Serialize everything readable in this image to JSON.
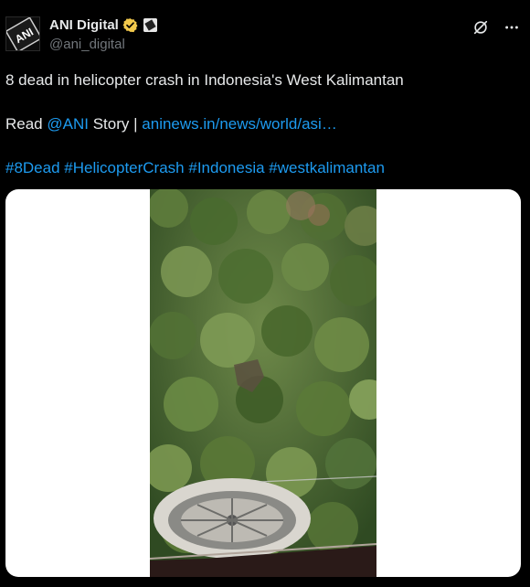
{
  "author": {
    "display_name": "ANI Digital",
    "handle": "@ani_digital",
    "avatar_text": "ANI",
    "verified_badge": "gold-check",
    "affiliate_badge": "ANI"
  },
  "tweet": {
    "headline": "8 dead in helicopter crash in Indonesia's West Kalimantan",
    "read_prefix": "Read",
    "mention": "@ANI",
    "story_label": "Story |",
    "link_text": "aninews.in/news/world/asi…",
    "hashtags": [
      "#8Dead",
      "#HelicopterCrash",
      "#Indonesia",
      "#westkalimantan"
    ]
  },
  "colors": {
    "background": "#000000",
    "text": "#e7e9ea",
    "secondary": "#71767b",
    "link": "#1d9bf0",
    "badge_gold": "#f2c94c"
  },
  "icons": {
    "grok": "grok-icon",
    "more": "more-icon"
  },
  "media": {
    "type": "video-thumbnail",
    "subject": "aerial-forest-crash-site"
  }
}
